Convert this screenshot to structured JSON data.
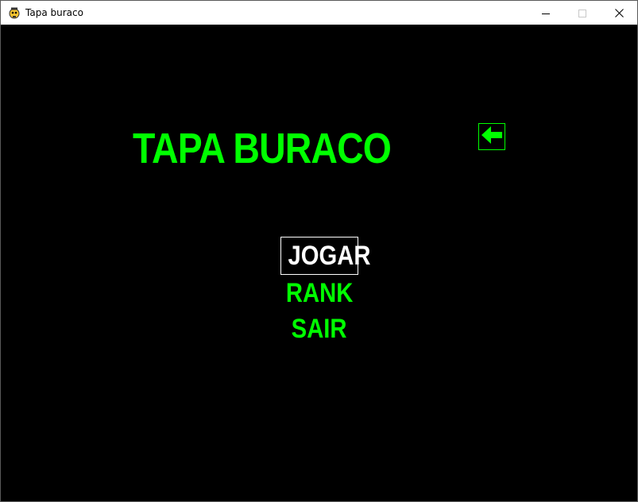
{
  "window": {
    "title": "Tapa buraco",
    "icon": "pygame-snake-icon",
    "controls": {
      "minimize_icon": "minimize-icon",
      "maximize_icon": "maximize-icon",
      "close_icon": "close-icon"
    }
  },
  "game": {
    "title": "TAPA BURACO",
    "back_icon": "arrow-left-icon",
    "menu": {
      "items": [
        {
          "label": "JOGAR",
          "selected": true
        },
        {
          "label": "RANK",
          "selected": false
        },
        {
          "label": "SAIR",
          "selected": false
        }
      ]
    }
  },
  "colors": {
    "background": "#000000",
    "accent": "#00ff00",
    "selected_text": "#ffffff",
    "titlebar": "#ffffff"
  }
}
